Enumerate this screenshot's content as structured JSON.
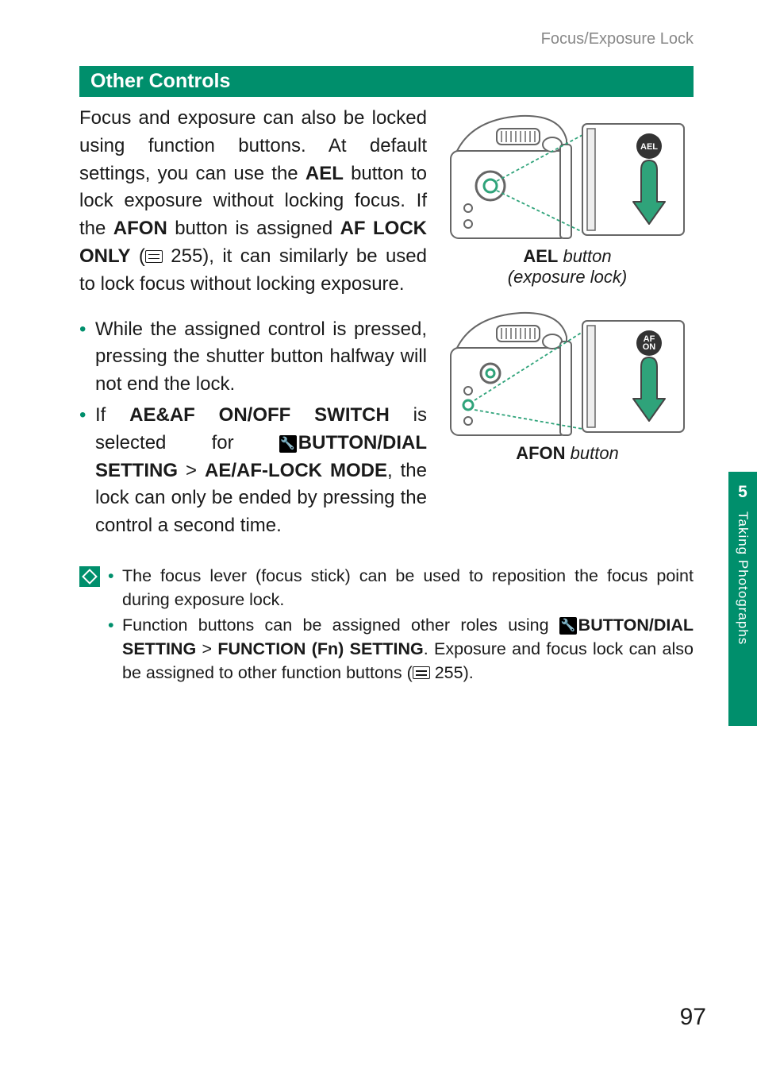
{
  "running_head": "Focus/Exposure Lock",
  "section_title": "Other Controls",
  "intro": {
    "t1": "Focus and exposure can also be locked using function buttons. At default settings, you can use the ",
    "b1": "AEL",
    "t2": " button to lock exposure without locking focus. If the ",
    "b2": "AFON",
    "t3": " button is assigned ",
    "b3": "AF LOCK ONLY",
    "t4": " (",
    "ref": " 255), it can similarly be used to lock focus without locking exposure."
  },
  "bullets": [
    {
      "text": "While the assigned control is pressed, pressing the shutter button halfway will not end the lock."
    },
    {
      "pre": "If ",
      "b1": "AE&AF ON/OFF SWITCH",
      "mid1": " is selected for ",
      "b2": "BUTTON/DIAL SETTING",
      "gt": " > ",
      "b3": "AE/AF-LOCK MODE",
      "post": ", the lock can only be ended by pressing the control a second time."
    }
  ],
  "captions": {
    "ael_b": "AEL",
    "ael_i": " button",
    "ael_sub": "(exposure lock)",
    "afon_b": "AFON",
    "afon_i": " button"
  },
  "labels": {
    "ael": "AEL",
    "afon1": "AF",
    "afon2": "ON"
  },
  "notes": [
    {
      "text": "The focus lever (focus stick) can be used to reposition the focus point during exposure lock."
    },
    {
      "pre": "Function buttons can be assigned other roles using ",
      "b1": "BUTTON/DIAL SETTING",
      "gt": " > ",
      "b2": "FUNCTION (Fn) SETTING",
      "post1": ". Exposure and focus lock can also be assigned to other function buttons (",
      "ref": " 255)."
    }
  ],
  "sidebar": {
    "chapter": "5",
    "title": "Taking Photographs"
  },
  "page_number": "97"
}
